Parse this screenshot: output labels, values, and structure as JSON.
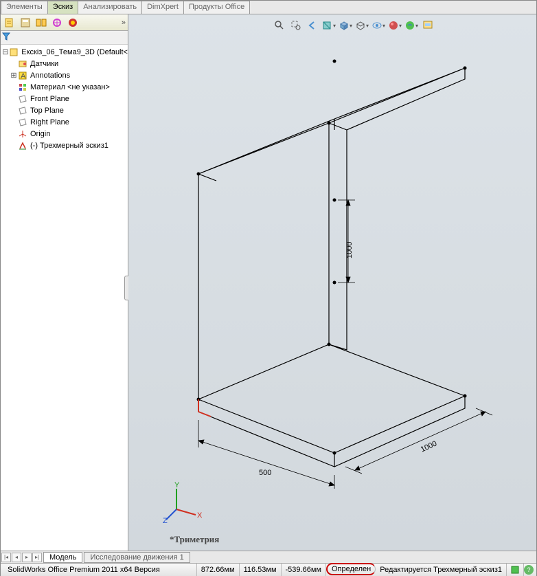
{
  "tabs": {
    "elements": "Элементы",
    "sketch": "Эскиз",
    "analyze": "Анализировать",
    "dimxpert": "DimXpert",
    "office": "Продукты Office"
  },
  "tree": {
    "root": "Екскіз_06_Тема9_3D  (Default<",
    "sensors": "Датчики",
    "annotations": "Annotations",
    "material": "Материал <не указан>",
    "front": "Front Plane",
    "top": "Top Plane",
    "right": "Right Plane",
    "origin": "Origin",
    "sketch3d": "(-) Трехмерный эскиз1"
  },
  "dims": {
    "d500": "500",
    "d1000v": "1000",
    "d1000d": "1000"
  },
  "view_label": "*Триметрия",
  "triad": {
    "x": "X",
    "y": "Y",
    "z": "Z"
  },
  "bottom_tabs": {
    "model": "Модель",
    "motion": "Исследование движения 1"
  },
  "status": {
    "product": "SolidWorks Office Premium 2011 x64 Версия",
    "coord1": "872.66мм",
    "coord2": "116.53мм",
    "coord3": "-539.66мм",
    "defined": "Определен",
    "editing": "Редактируется Трехмерный эскиз1"
  }
}
